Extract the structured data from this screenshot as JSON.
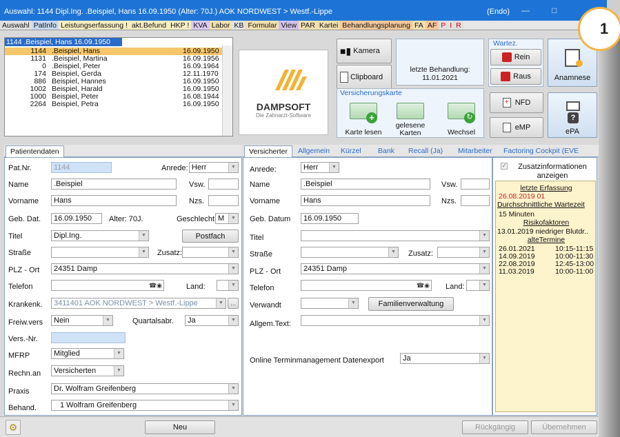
{
  "titlebar": {
    "title": "Auswahl: 1144  Dipl.Ing. .Beispiel, Hans  16.09.1950 (Alter: 70J.)  AOK NORDWEST > Westf.-Lippe",
    "context": "(Endo)"
  },
  "menu": [
    "Auswahl",
    "PatInfo",
    "Leistungserfassung !",
    "akt.Befund",
    "HKP !",
    "KVA",
    "Labor",
    "KB",
    "Formular",
    "View",
    "PAR",
    "Kartei",
    "Behandlungsplanung",
    "FA",
    "AF",
    "P",
    "I",
    "R"
  ],
  "callout": "1",
  "patientlist": {
    "selected": "1144 .Beispiel, Hans  16.09.1950",
    "rows": [
      {
        "num": "1144",
        "name": ".Beispiel, Hans",
        "date": "16.09.1950"
      },
      {
        "num": "1131",
        "name": ".Beispiel, Martina",
        "date": "16.09.1956"
      },
      {
        "num": "0",
        "name": ".Beispiel, Peter",
        "date": "16.09.1964"
      },
      {
        "num": "174",
        "name": "Beispiel, Gerda",
        "date": "12.11.1970"
      },
      {
        "num": "886",
        "name": "Beispiel, Hannes",
        "date": "16.09.1950"
      },
      {
        "num": "1002",
        "name": "Beispiel, Harald",
        "date": "16.09.1950"
      },
      {
        "num": "1000",
        "name": "Beispiel, Peter",
        "date": "16.08.1944"
      },
      {
        "num": "2264",
        "name": "Beispiel, Petra",
        "date": "16.09.1950"
      }
    ]
  },
  "logo": {
    "name": "DAMPSOFT",
    "tagline": "Die Zahnarzt-Software"
  },
  "buttons": {
    "kamera": "Kamera",
    "clipboard": "Clipboard",
    "rein": "Rein",
    "raus": "Raus",
    "anamnese": "Anamnese",
    "nfd": "NFD",
    "emp": "eMP",
    "epa": "ePA",
    "karte_lesen": "Karte lesen",
    "gelesene": "gelesene Karten",
    "wechsel": "Wechsel",
    "postfach": "Postfach",
    "familie": "Familienverwaltung",
    "neu": "Neu",
    "rueck": "Rückgängig",
    "ueber": "Übernehmen"
  },
  "letzte_behandlung": {
    "label": "letzte Behandlung:",
    "date": "11.01.2021"
  },
  "groups": {
    "versicherungskarte": "Versicherungskarte",
    "wartez": "Wartez."
  },
  "tabs_left": [
    "Patientendaten"
  ],
  "tabs_right": [
    "Versicherter",
    "Allgemein",
    "Kürzel",
    "Bank",
    "Recall (Ja)",
    "Mitarbeiter",
    "Factoring Cockpit (EVE"
  ],
  "left": {
    "patnr_label": "Pat.Nr.",
    "patnr": "1144",
    "anrede_label": "Anrede:",
    "anrede": "Herr",
    "name_label": "Name",
    "name": ".Beispiel",
    "vsw_label": "Vsw.",
    "vorname_label": "Vorname",
    "vorname": "Hans",
    "nzs_label": "Nzs.",
    "gebdat_label": "Geb. Dat.",
    "gebdat": "16.09.1950",
    "alter": "Alter: 70J.",
    "geschlecht_label": "Geschlecht:",
    "geschlecht": "M",
    "titel_label": "Titel",
    "titel": "Dipl.Ing.",
    "strasse_label": "Straße",
    "zusatz_label": "Zusatz:",
    "plz_label": "PLZ - Ort",
    "plz": "24351 Damp",
    "telefon_label": "Telefon",
    "land_label": "Land:",
    "krankenk_label": "Krankenk.",
    "krankenk": "3411401 AOK NORDWEST > Westf.-Lippe",
    "freiw_label": "Freiw.vers",
    "freiw": "Nein",
    "quartal_label": "Quartalsabr.",
    "quartal": "Ja",
    "versnr_label": "Vers.-Nr.",
    "mfrp_label": "MFRP",
    "mfrp": "Mitglied",
    "rechn_label": "Rechn.an",
    "rechn": "Versicherten",
    "praxis_label": "Praxis",
    "praxis": "Dr. Wolfram Greifenberg",
    "behand_label": "Behand.",
    "behand": "1 Wolfram Greifenberg"
  },
  "right": {
    "anrede_label": "Anrede:",
    "anrede": "Herr",
    "name_label": "Name",
    "name": ".Beispiel",
    "vsw_label": "Vsw.",
    "vorname_label": "Vorname",
    "vorname": "Hans",
    "nzs_label": "Nzs.",
    "gebdat_label": "Geb. Datum",
    "gebdat": "16.09.1950",
    "titel_label": "Titel",
    "strasse_label": "Straße",
    "zusatz_label": "Zusatz:",
    "plz_label": "PLZ - Ort",
    "plz": "24351 Damp",
    "telefon_label": "Telefon",
    "land_label": "Land:",
    "verwandt_label": "Verwandt",
    "allgem_label": "Allgem.Text:",
    "online_label": "Online Terminmanagement Datenexport",
    "online": "Ja"
  },
  "info": {
    "zusatz": "Zusatzinformationen anzeigen",
    "lines": [
      "letzte Erfassung",
      "26.08.2019 01",
      "Durchschnittliche Wartezeit",
      "15 Minuten",
      "Risikofaktoren",
      "13.01.2019 niedriger Blutdr..",
      "alteTermine"
    ],
    "termine": [
      {
        "d": "26.01.2021",
        "t": "10:15-11:15"
      },
      {
        "d": "14.09.2019",
        "t": "10:00-11:30"
      },
      {
        "d": "22.08.2019",
        "t": "12:45-13:00"
      },
      {
        "d": "11.03.2019",
        "t": "10:00-11:00"
      }
    ]
  }
}
